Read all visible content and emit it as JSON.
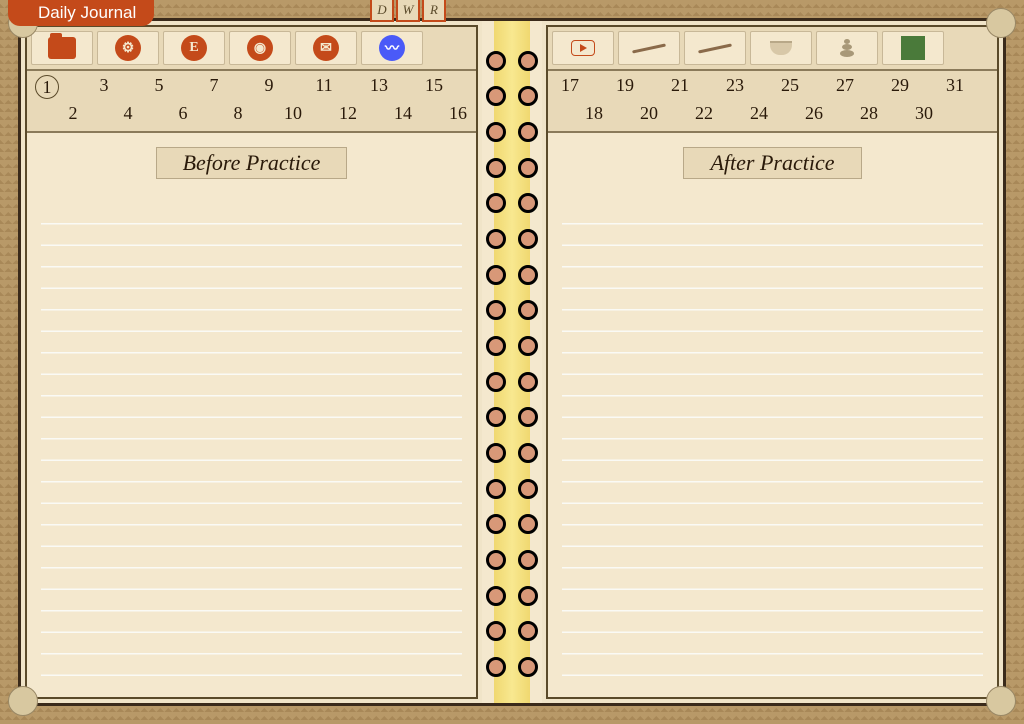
{
  "title": "Daily Journal",
  "view_tabs": [
    "D",
    "W",
    "R"
  ],
  "toolbar_left": [
    {
      "name": "folder-icon",
      "kind": "folder"
    },
    {
      "name": "web-icon",
      "kind": "orange",
      "glyph": "⚙"
    },
    {
      "name": "etsy-icon",
      "kind": "orange",
      "glyph": "E"
    },
    {
      "name": "pinterest-icon",
      "kind": "orange",
      "glyph": "◉"
    },
    {
      "name": "mail-icon",
      "kind": "orange",
      "glyph": "✉"
    },
    {
      "name": "freeform-icon",
      "kind": "blue",
      "glyph": "〰"
    }
  ],
  "toolbar_right": [
    {
      "name": "video-icon",
      "kind": "play"
    },
    {
      "name": "incense-icon",
      "kind": "stick"
    },
    {
      "name": "flute-icon",
      "kind": "stick"
    },
    {
      "name": "bowl-icon",
      "kind": "bowl"
    },
    {
      "name": "stones-icon",
      "kind": "stones"
    },
    {
      "name": "bamboo-icon",
      "kind": "square"
    }
  ],
  "days_left_top": [
    1,
    3,
    5,
    7,
    9,
    11,
    13,
    15
  ],
  "days_left_bottom": [
    2,
    4,
    6,
    8,
    10,
    12,
    14,
    16
  ],
  "days_right_top": [
    17,
    19,
    21,
    23,
    25,
    27,
    29,
    31
  ],
  "days_right_bottom": [
    18,
    20,
    22,
    24,
    26,
    28,
    30
  ],
  "selected_day": 1,
  "heading_left": "Before Practice",
  "heading_right": "After Practice"
}
